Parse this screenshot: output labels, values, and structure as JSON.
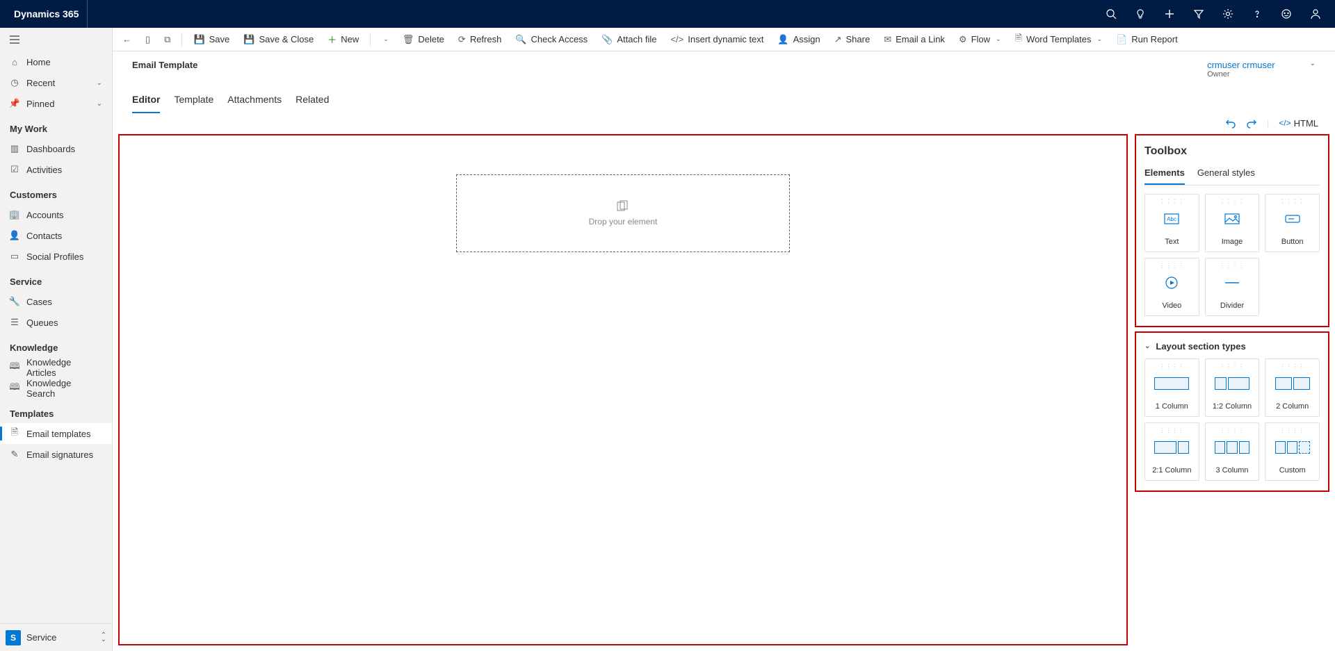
{
  "brand": "Dynamics 365",
  "sidebar": {
    "home": "Home",
    "recent": "Recent",
    "pinned": "Pinned",
    "myWorkHeader": "My Work",
    "dashboards": "Dashboards",
    "activities": "Activities",
    "customersHeader": "Customers",
    "accounts": "Accounts",
    "contacts": "Contacts",
    "socialProfiles": "Social Profiles",
    "serviceHeader": "Service",
    "cases": "Cases",
    "queues": "Queues",
    "knowledgeHeader": "Knowledge",
    "knowledgeArticles": "Knowledge Articles",
    "knowledgeSearch": "Knowledge Search",
    "templatesHeader": "Templates",
    "emailTemplates": "Email templates",
    "emailSignatures": "Email signatures",
    "appBadge": "S",
    "appName": "Service"
  },
  "commands": {
    "save": "Save",
    "saveClose": "Save & Close",
    "new": "New",
    "delete": "Delete",
    "refresh": "Refresh",
    "checkAccess": "Check Access",
    "attachFile": "Attach file",
    "insertDynamicText": "Insert dynamic text",
    "assign": "Assign",
    "share": "Share",
    "emailLink": "Email a Link",
    "flow": "Flow",
    "wordTemplates": "Word Templates",
    "runReport": "Run Report"
  },
  "page": {
    "title": "Email Template",
    "ownerName": "crmuser crmuser",
    "ownerLabel": "Owner",
    "tabs": {
      "editor": "Editor",
      "template": "Template",
      "attachments": "Attachments",
      "related": "Related"
    }
  },
  "editor": {
    "htmlButton": "HTML",
    "dropText": "Drop your element"
  },
  "toolbox": {
    "title": "Toolbox",
    "tabElements": "Elements",
    "tabStyles": "General styles",
    "elements": {
      "text": "Text",
      "image": "Image",
      "button": "Button",
      "video": "Video",
      "divider": "Divider"
    },
    "layoutHeader": "Layout section types",
    "layouts": {
      "c1": "1 Column",
      "c12": "1:2 Column",
      "c2": "2 Column",
      "c21": "2:1 Column",
      "c3": "3 Column",
      "custom": "Custom"
    }
  }
}
